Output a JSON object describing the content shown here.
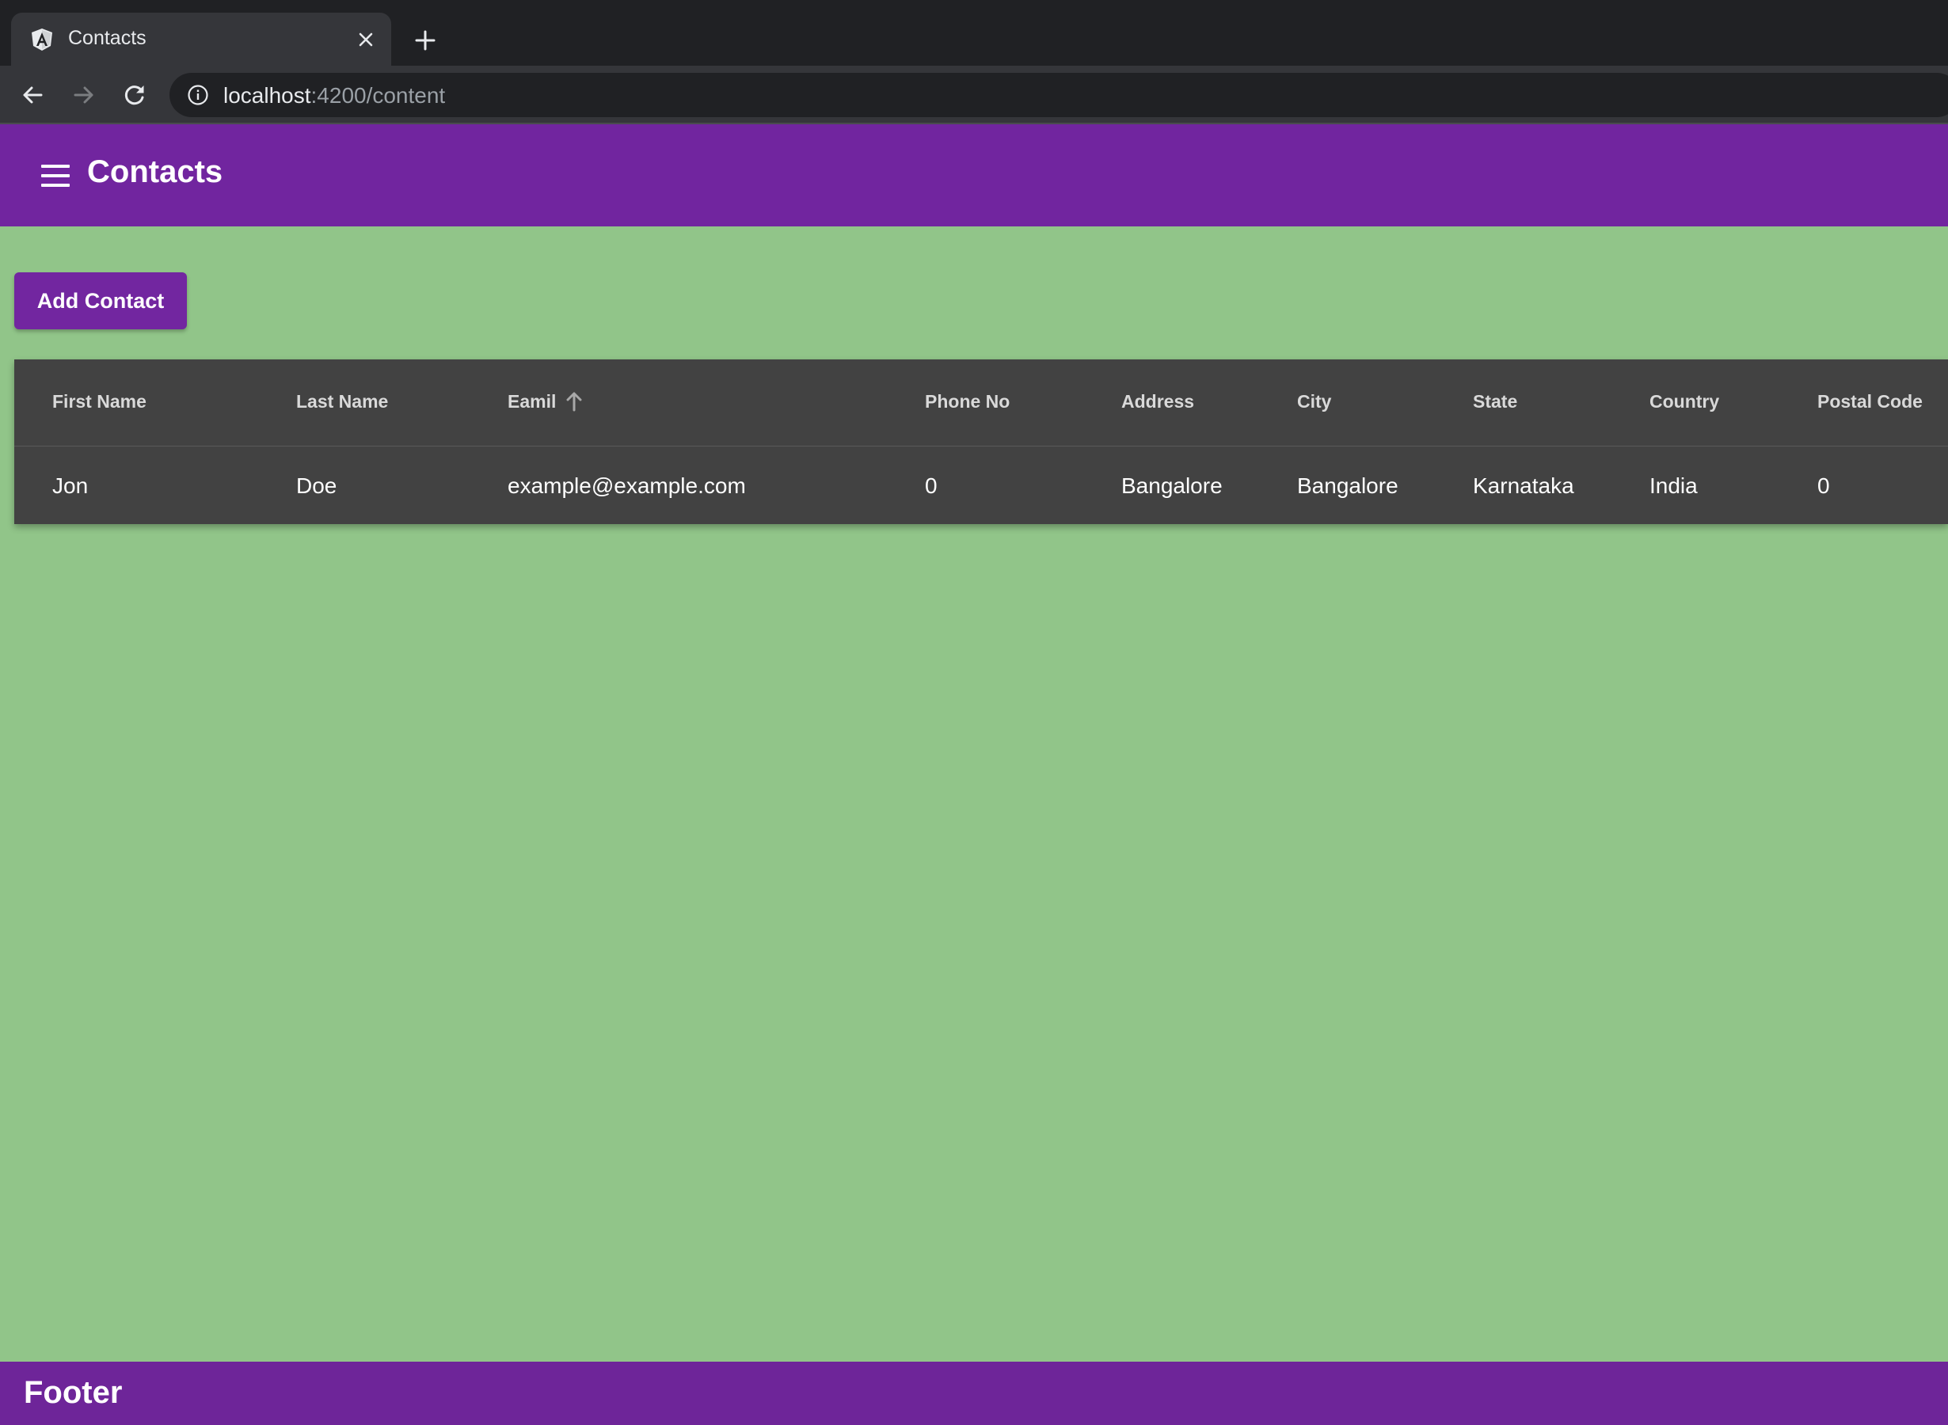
{
  "browser": {
    "tab_title": "Contacts",
    "url_host": "localhost",
    "url_rest": ":4200/content"
  },
  "header": {
    "title": "Contacts"
  },
  "actions": {
    "add_contact_label": "Add Contact"
  },
  "table": {
    "columns": [
      "First Name",
      "Last Name",
      "Eamil",
      "Phone No",
      "Address",
      "City",
      "State",
      "Country",
      "Postal Code"
    ],
    "sorted_column": "Eamil",
    "sort_direction": "ascending",
    "rows": [
      [
        "Jon",
        "Doe",
        "example@example.com",
        "0",
        "Bangalore",
        "Bangalore",
        "Karnataka",
        "India",
        "0"
      ]
    ]
  },
  "footer": {
    "text": "Footer"
  },
  "colors": {
    "primary": "#71259f",
    "background": "#91c589",
    "table_background": "#424242"
  }
}
